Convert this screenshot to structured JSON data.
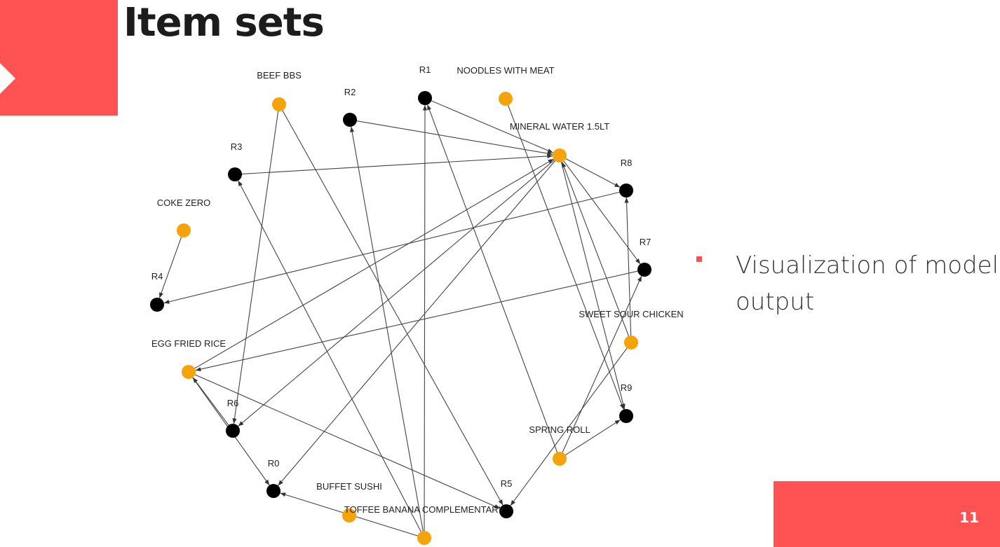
{
  "slide": {
    "title": "Item sets",
    "bullet_text": "Visualization of model output",
    "page_number": "11",
    "accent_color": "#ff5252"
  },
  "graph": {
    "colors": {
      "item": "#f5a30a",
      "rule": "#000000",
      "edge": "#444444"
    },
    "nodes": [
      {
        "id": "R1",
        "label": "R1",
        "kind": "rule"
      },
      {
        "id": "NOODLES",
        "label": "NOODLES WITH MEAT",
        "kind": "item"
      },
      {
        "id": "BEEF",
        "label": "BEEF BBS",
        "kind": "item"
      },
      {
        "id": "R2",
        "label": "R2",
        "kind": "rule"
      },
      {
        "id": "MINERAL",
        "label": "MINERAL WATER 1.5LT",
        "kind": "item"
      },
      {
        "id": "R3",
        "label": "R3",
        "kind": "rule"
      },
      {
        "id": "R8",
        "label": "R8",
        "kind": "rule"
      },
      {
        "id": "COKE",
        "label": "COKE ZERO",
        "kind": "item"
      },
      {
        "id": "R7",
        "label": "R7",
        "kind": "rule"
      },
      {
        "id": "R4",
        "label": "R4",
        "kind": "rule"
      },
      {
        "id": "SWEET",
        "label": "SWEET SOUR CHICKEN",
        "kind": "item"
      },
      {
        "id": "EGG",
        "label": "EGG FRIED RICE",
        "kind": "item"
      },
      {
        "id": "R6",
        "label": "R6",
        "kind": "rule"
      },
      {
        "id": "R9",
        "label": "R9",
        "kind": "rule"
      },
      {
        "id": "SPRING",
        "label": "SPRING ROLL",
        "kind": "item"
      },
      {
        "id": "R0",
        "label": "R0",
        "kind": "rule"
      },
      {
        "id": "SUSHI",
        "label": "BUFFET SUSHI",
        "kind": "item"
      },
      {
        "id": "R5",
        "label": "R5",
        "kind": "rule"
      },
      {
        "id": "TOFFEE",
        "label": "TOFFEE BANANA COMPLEMENTARY",
        "kind": "item"
      }
    ],
    "edges": [
      {
        "from": "R1",
        "to": "MINERAL"
      },
      {
        "from": "R2",
        "to": "MINERAL"
      },
      {
        "from": "R3",
        "to": "MINERAL"
      },
      {
        "from": "MINERAL",
        "to": "R8"
      },
      {
        "from": "MINERAL",
        "to": "R7"
      },
      {
        "from": "MINERAL",
        "to": "R9"
      },
      {
        "from": "MINERAL",
        "to": "R6"
      },
      {
        "from": "MINERAL",
        "to": "R0"
      },
      {
        "from": "EGG",
        "to": "MINERAL"
      },
      {
        "from": "R8",
        "to": "R4"
      },
      {
        "from": "R7",
        "to": "EGG"
      },
      {
        "from": "EGG",
        "to": "R0"
      },
      {
        "from": "EGG",
        "to": "R5"
      },
      {
        "from": "R6",
        "to": "EGG"
      },
      {
        "from": "COKE",
        "to": "R4"
      },
      {
        "from": "BEEF",
        "to": "R6"
      },
      {
        "from": "BEEF",
        "to": "R5"
      },
      {
        "from": "NOODLES",
        "to": "R9"
      },
      {
        "from": "TOFFEE",
        "to": "R2"
      },
      {
        "from": "TOFFEE",
        "to": "R1"
      },
      {
        "from": "TOFFEE",
        "to": "R3"
      },
      {
        "from": "TOFFEE",
        "to": "R0"
      },
      {
        "from": "SPRING",
        "to": "R1"
      },
      {
        "from": "SPRING",
        "to": "R9"
      },
      {
        "from": "SPRING",
        "to": "R7"
      },
      {
        "from": "SWEET",
        "to": "R8"
      },
      {
        "from": "SWEET",
        "to": "MINERAL"
      },
      {
        "from": "SWEET",
        "to": "R5"
      }
    ]
  }
}
